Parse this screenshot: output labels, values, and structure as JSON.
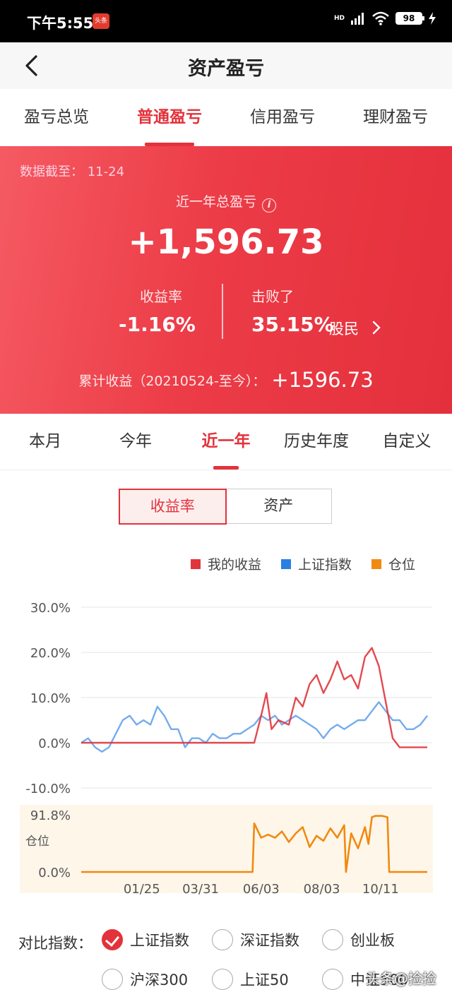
{
  "status_bar": {
    "time": "下午5:55",
    "app_badge": "头条",
    "hd": "HD",
    "battery": "98"
  },
  "nav": {
    "title": "资产盈亏"
  },
  "tabs": [
    {
      "label": "盈亏总览"
    },
    {
      "label": "普通盈亏"
    },
    {
      "label": "信用盈亏"
    },
    {
      "label": "理财盈亏"
    }
  ],
  "summary": {
    "as_of_label": "数据截至：",
    "as_of_date": "11-24",
    "year_label": "近一年总盈亏",
    "total": "+1,596.73",
    "rate_label": "收益率",
    "rate_value": "-1.16%",
    "beat_label": "击败了",
    "beat_value": "35.15%",
    "beat_unit": "股民",
    "cum_label": "累计收益（20210524-至今）：",
    "cum_value": "+1596.73"
  },
  "periods": [
    {
      "label": "本月"
    },
    {
      "label": "今年"
    },
    {
      "label": "近一年"
    },
    {
      "label": "历史年度"
    },
    {
      "label": "自定义"
    }
  ],
  "segment": {
    "rate": "收益率",
    "asset": "资产"
  },
  "legend": [
    {
      "name": "我的收益",
      "color": "#e0353c"
    },
    {
      "name": "上证指数",
      "color": "#2a7fe3"
    },
    {
      "name": "仓位",
      "color": "#f08a10"
    }
  ],
  "compare": {
    "label": "对比指数：",
    "options": [
      {
        "name": "上证指数",
        "checked": true
      },
      {
        "name": "深证指数",
        "checked": false
      },
      {
        "name": "创业板",
        "checked": false
      },
      {
        "name": "沪深300",
        "checked": false
      },
      {
        "name": "上证50",
        "checked": false
      },
      {
        "name": "中证500",
        "checked": false
      }
    ]
  },
  "watermark": "头条@捡捡",
  "chart_data": [
    {
      "type": "line",
      "y_tick_labels": [
        "30.0%",
        "20.0%",
        "10.0%",
        "0.0%",
        "-10.0%"
      ],
      "ylim": [
        -10,
        30
      ],
      "grid": true,
      "series": [
        {
          "name": "我的收益",
          "color": "#e0353c",
          "x": [
            0,
            0.1,
            0.2,
            0.3,
            0.4,
            0.5,
            0.52,
            0.535,
            0.55,
            0.57,
            0.6,
            0.62,
            0.64,
            0.66,
            0.68,
            0.7,
            0.72,
            0.74,
            0.76,
            0.78,
            0.8,
            0.82,
            0.84,
            0.86,
            0.88,
            0.9,
            0.92,
            0.94,
            0.96,
            0.98,
            1.0
          ],
          "values": [
            0,
            0,
            0,
            0,
            0,
            0,
            6,
            11,
            3,
            5,
            4,
            10,
            8,
            13,
            15,
            11,
            14,
            18,
            14,
            15,
            12,
            19,
            21,
            17,
            9,
            1,
            -1,
            -1,
            -1,
            -1,
            -1
          ]
        },
        {
          "name": "上证指数",
          "color": "#2a7fe3",
          "x": [
            0,
            0.02,
            0.04,
            0.06,
            0.08,
            0.1,
            0.12,
            0.14,
            0.16,
            0.18,
            0.2,
            0.22,
            0.24,
            0.26,
            0.28,
            0.3,
            0.32,
            0.34,
            0.36,
            0.38,
            0.4,
            0.42,
            0.44,
            0.46,
            0.48,
            0.5,
            0.52,
            0.54,
            0.56,
            0.58,
            0.6,
            0.62,
            0.64,
            0.66,
            0.68,
            0.7,
            0.72,
            0.74,
            0.76,
            0.78,
            0.8,
            0.82,
            0.84,
            0.86,
            0.88,
            0.9,
            0.92,
            0.94,
            0.96,
            0.98,
            1.0
          ],
          "values": [
            0,
            1,
            -1,
            -2,
            -1,
            2,
            5,
            6,
            4,
            5,
            4,
            8,
            6,
            3,
            3,
            -1,
            1,
            1,
            0,
            2,
            1,
            1,
            2,
            2,
            3,
            4,
            6,
            5,
            6,
            4,
            5,
            6,
            5,
            4,
            3,
            1,
            3,
            4,
            3,
            4,
            5,
            5,
            7,
            9,
            7,
            5,
            5,
            3,
            3,
            4,
            6
          ]
        }
      ]
    },
    {
      "type": "area",
      "y_tick_labels": [
        "91.8%",
        "0.0%"
      ],
      "ylabel": "仓位",
      "ylim": [
        0,
        91.8
      ],
      "x_tick_labels": [
        "01/25",
        "03/31",
        "06/03",
        "08/03",
        "10/11"
      ],
      "series": [
        {
          "name": "仓位",
          "color": "#f08a10",
          "x": [
            0,
            0.48,
            0.495,
            0.5,
            0.52,
            0.54,
            0.56,
            0.58,
            0.6,
            0.62,
            0.64,
            0.66,
            0.68,
            0.7,
            0.72,
            0.74,
            0.76,
            0.765,
            0.78,
            0.8,
            0.82,
            0.83,
            0.84,
            0.85,
            0.87,
            0.885,
            0.89,
            1.0
          ],
          "values": [
            0,
            0,
            0,
            78,
            55,
            60,
            55,
            65,
            48,
            62,
            72,
            40,
            58,
            50,
            70,
            55,
            75,
            0,
            62,
            38,
            72,
            45,
            88,
            90,
            90,
            88,
            0,
            0
          ]
        }
      ]
    }
  ]
}
